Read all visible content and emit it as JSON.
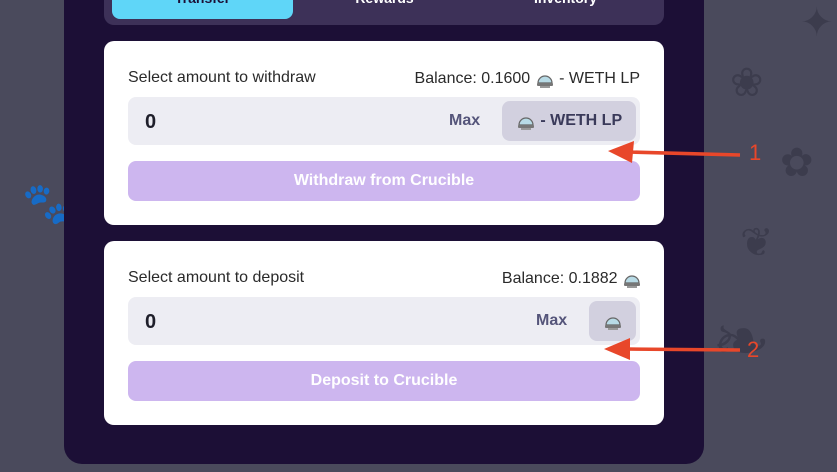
{
  "tabs": [
    {
      "label": "Transfer"
    },
    {
      "label": "Rewards"
    },
    {
      "label": "Inventory"
    }
  ],
  "withdraw": {
    "label": "Select amount to withdraw",
    "balance_text": "Balance: 0.1600",
    "balance_token": "- WETH LP",
    "amount": "0",
    "max_label": "Max",
    "token_label": "- WETH LP",
    "button_label": "Withdraw from Crucible"
  },
  "deposit": {
    "label": "Select amount to deposit",
    "balance_text": "Balance: 0.1882",
    "amount": "0",
    "max_label": "Max",
    "button_label": "Deposit to Crucible"
  },
  "annotations": [
    "1",
    "2"
  ],
  "colors": {
    "accent_tab": "#5fd6f8",
    "button": "#cdb6ef",
    "arrow": "#e8472a",
    "panel": "#1c0f36"
  },
  "icons": [
    "crucible-token-icon",
    "annotation-arrow-icon"
  ]
}
